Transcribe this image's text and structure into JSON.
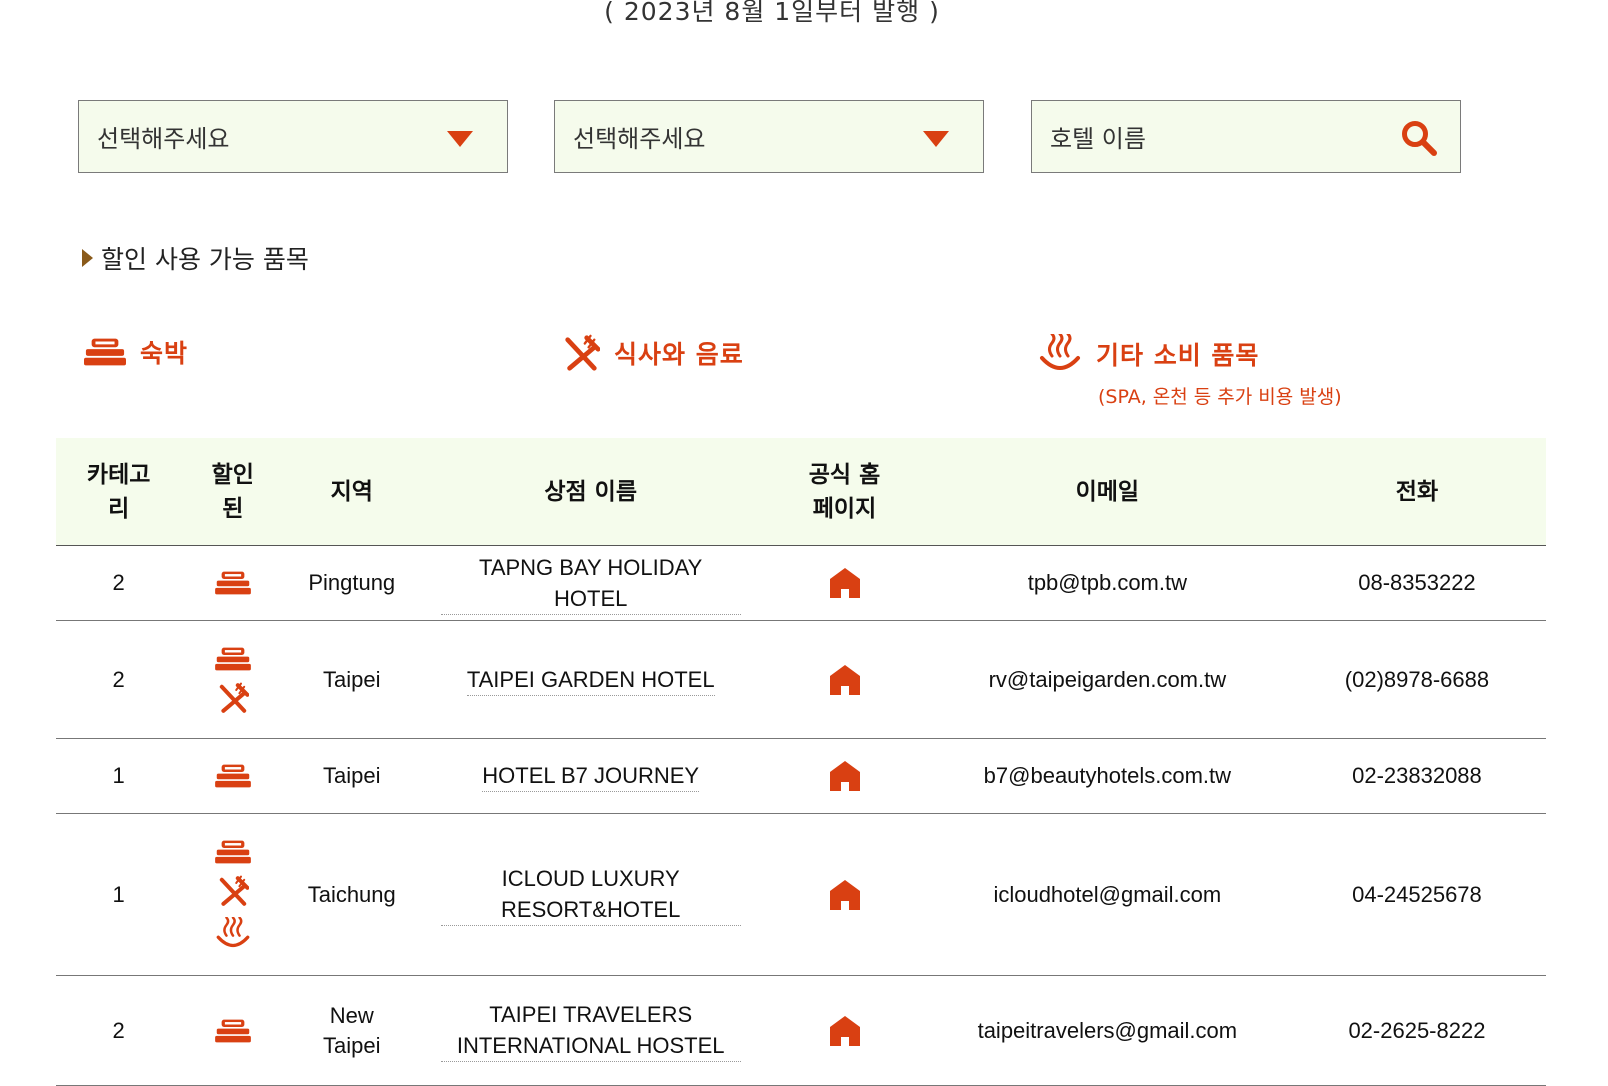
{
  "header": {
    "issue_note": "( 2023년 8월 1일부터 발행 )"
  },
  "filters": {
    "select_1": {
      "value": "선택해주세요"
    },
    "select_2": {
      "value": "선택해주세요"
    },
    "hotel_search": {
      "placeholder": "호텔 이름"
    }
  },
  "section": {
    "title": "할인 사용 가능 품목"
  },
  "legend": {
    "lodging": "숙박",
    "dining": "식사와 음료",
    "other": "기타 소비 품목",
    "other_note": "(SPA, 온천 등 추가 비용 발생)"
  },
  "table": {
    "headers": {
      "category": "카테고리",
      "discount": "할인된",
      "region": "지역",
      "store": "상점 이름",
      "homepage": "공식 홈페이지",
      "email": "이메일",
      "phone": "전화"
    },
    "rows": [
      {
        "category": "2",
        "discounts": [
          "bed-icon"
        ],
        "region": "Pingtung",
        "store": "TAPNG BAY HOLIDAY HOTEL",
        "email": "tpb@tpb.com.tw",
        "phone": "08-8353222"
      },
      {
        "category": "2",
        "discounts": [
          "bed-icon",
          "fork-knife-icon"
        ],
        "region": "Taipei",
        "store": "TAIPEI GARDEN HOTEL",
        "email": "rv@taipeigarden.com.tw",
        "phone": "(02)8978-6688"
      },
      {
        "category": "1",
        "discounts": [
          "bed-icon"
        ],
        "region": "Taipei",
        "store": "HOTEL B7 JOURNEY",
        "email": "b7@beautyhotels.com.tw",
        "phone": "02-23832088"
      },
      {
        "category": "1",
        "discounts": [
          "bed-icon",
          "fork-knife-icon",
          "hot-spring-icon"
        ],
        "region": "Taichung",
        "store": "ICLOUD LUXURY RESORT&HOTEL",
        "email": "icloudhotel@gmail.com",
        "phone": "04-24525678"
      },
      {
        "category": "2",
        "discounts": [
          "bed-icon"
        ],
        "region": "New Taipei",
        "store": "TAIPEI TRAVELERS INTERNATIONAL HOSTEL",
        "email": "taipeitravelers@gmail.com",
        "phone": "02-2625-8222"
      }
    ]
  },
  "colors": {
    "accent": "#d94012",
    "filter_bg": "#f5fbec",
    "header_bg": "#f5fcec"
  }
}
